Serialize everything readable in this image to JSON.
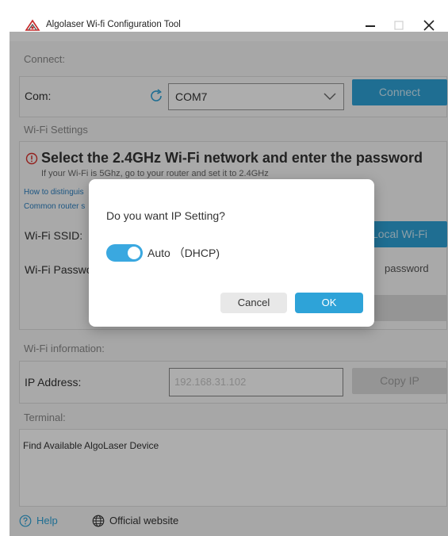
{
  "window": {
    "title": "Algolaser Wi-fi Configuration Tool"
  },
  "connect": {
    "section_label": "Connect:",
    "com_label": "Com:",
    "com_value": "COM7",
    "connect_button": "Connect"
  },
  "wifi_settings": {
    "section_label": "Wi-Fi Settings",
    "warning_title": "Select the 2.4GHz Wi-Fi network and enter the password",
    "warning_subtitle": "If your Wi-Fi is 5Ghz, go to your router and set it to 2.4GHz",
    "link_distinguish": "How to distinguis",
    "link_common_router": "Common router s",
    "ssid_label": "Wi-Fi SSID:",
    "local_wifi_button": "Local Wi-Fi",
    "password_label": "Wi-Fi Passwo",
    "password_hint": "password"
  },
  "wifi_information": {
    "section_label": "Wi-Fi information:",
    "ip_label": "IP Address:",
    "ip_value": "192.168.31.102",
    "copy_ip_button": "Copy IP"
  },
  "terminal": {
    "section_label": "Terminal:",
    "output": "Find Available AlgoLaser Device"
  },
  "footer": {
    "help_label": "Help",
    "website_label": "Official website"
  },
  "dialog": {
    "question": "Do you want IP Setting?",
    "toggle_label": "Auto （DHCP)",
    "toggle_on": true,
    "cancel_label": "Cancel",
    "ok_label": "OK"
  },
  "colors": {
    "accent": "#2ea3d8",
    "warning": "#d9302c",
    "link": "#2a7fc0",
    "toggle": "#3aa8e0"
  },
  "icons": [
    "app-logo-icon",
    "minimize-icon",
    "maximize-icon",
    "close-icon",
    "refresh-icon",
    "chevron-down-icon",
    "warning-icon",
    "help-icon",
    "globe-icon"
  ]
}
